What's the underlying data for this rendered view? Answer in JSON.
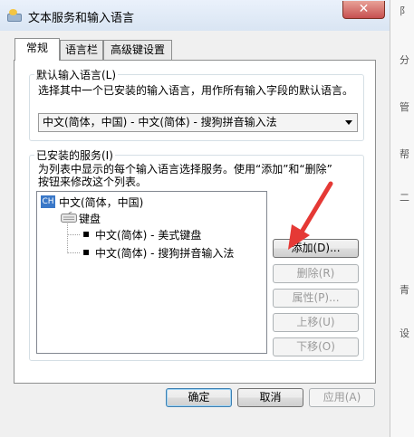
{
  "window": {
    "title": "文本服务和输入语言",
    "close_glyph": "✕"
  },
  "tabs": [
    {
      "label": "常规",
      "active": true
    },
    {
      "label": "语言栏",
      "active": false
    },
    {
      "label": "高级键设置",
      "active": false
    }
  ],
  "default_language": {
    "legend": "默认输入语言(L)",
    "description": "选择其中一个已安装的输入语言，用作所有输入字段的默认语言。",
    "selected": "中文(简体，中国) - 中文(简体) - 搜狗拼音输入法"
  },
  "installed_services": {
    "legend": "已安装的服务(I)",
    "description_line1": "为列表中显示的每个输入语言选择服务。使用“添加”和“删除”",
    "description_line2": "按钮来修改这个列表。",
    "tree": {
      "language_badge": "CH",
      "language": "中文(简体，中国)",
      "category": "键盘",
      "items": [
        "中文(简体) - 美式键盘",
        "中文(简体) - 搜狗拼音输入法"
      ]
    },
    "buttons": {
      "add": "添加(D)...",
      "remove": "删除(R)",
      "properties": "属性(P)...",
      "move_up": "上移(U)",
      "move_down": "下移(O)"
    }
  },
  "footer": {
    "ok": "确定",
    "cancel": "取消",
    "apply": "应用(A)"
  },
  "background_right_chars": [
    "阝",
    "分",
    "管",
    "帮",
    "二",
    "青",
    "设"
  ],
  "colors": {
    "annotation_arrow": "#e53935",
    "titlebar": "#dbe6f4",
    "close_button": "#c75050"
  }
}
